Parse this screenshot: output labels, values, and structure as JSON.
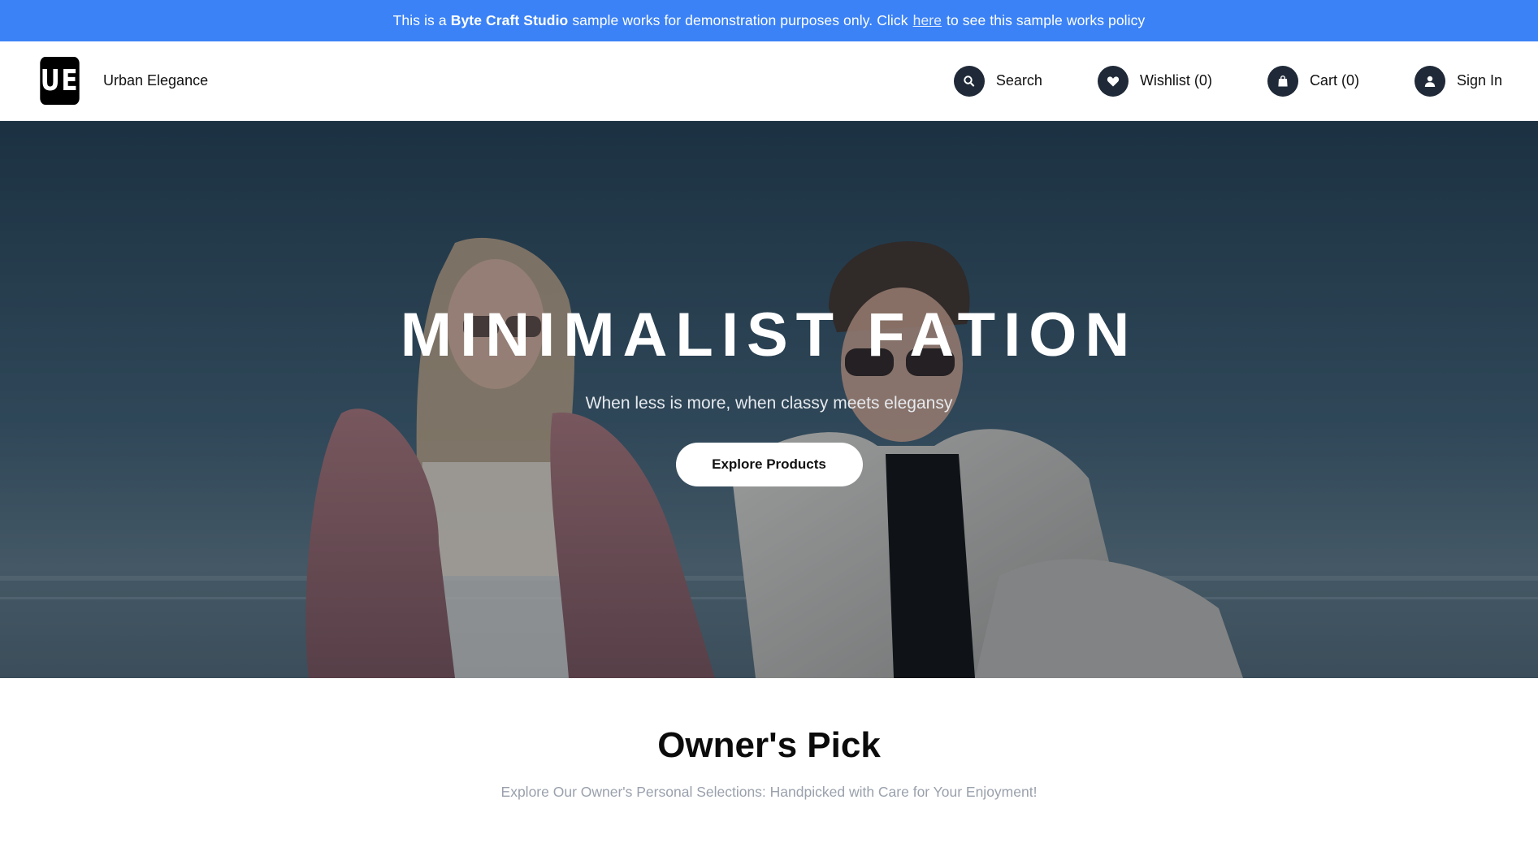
{
  "notice": {
    "prefix": "This is a",
    "studio": "Byte Craft Studio",
    "middle": "sample works for demonstration purposes only. Click",
    "link": "here",
    "suffix": "to see this sample works policy"
  },
  "header": {
    "logo_text": "UE",
    "brand_name": "Urban Elegance",
    "nav": {
      "search": "Search",
      "wishlist": "Wishlist (0)",
      "cart": "Cart (0)",
      "signin": "Sign In"
    }
  },
  "hero": {
    "title": "MINIMALIST FATION",
    "subtitle": "When less is more, when classy meets elegansy",
    "cta": "Explore Products"
  },
  "owners_pick": {
    "title": "Owner's Pick",
    "subtitle": "Explore Our Owner's Personal Selections: Handpicked with Care for Your Enjoyment!"
  },
  "colors": {
    "notice_bg": "#3b82f6",
    "icon_bg": "#1f2937",
    "hero_bg": "#2c4557"
  },
  "icons": [
    "search-icon",
    "heart-icon",
    "shopping-bag-icon",
    "user-icon"
  ]
}
